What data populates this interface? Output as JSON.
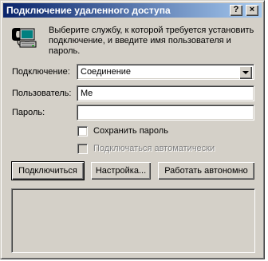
{
  "window": {
    "title": "Подключение удаленного доступа",
    "help_button": "?",
    "close_button": "×"
  },
  "description": "Выберите службу, к которой требуется установить подключение, и введите имя пользователя и пароль.",
  "form": {
    "connection_label": "Подключение:",
    "connection_value": "Соединение",
    "user_label": "Пользователь:",
    "user_value": "Me",
    "password_label": "Пароль:",
    "password_value": "",
    "save_password_label": "Сохранить пароль",
    "auto_connect_label": "Подключаться автоматически"
  },
  "buttons": {
    "connect": "Подключиться",
    "settings": "Настройка...",
    "offline": "Работать автономно"
  },
  "colors": {
    "face": "#d4d0c8",
    "title_start": "#0a246a",
    "title_end": "#a6caf0"
  },
  "icons": {
    "app": "dialup-computer-icon",
    "combo": "chevron-down-icon"
  }
}
